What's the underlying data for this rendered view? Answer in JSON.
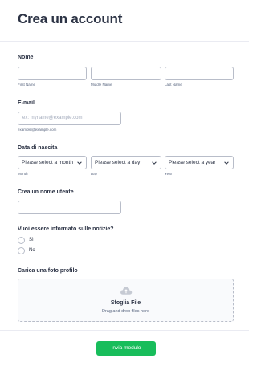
{
  "header": {
    "title": "Crea un account"
  },
  "name": {
    "label": "Nome",
    "fields": [
      {
        "sublabel": "First Name",
        "value": ""
      },
      {
        "sublabel": "Middle Name",
        "value": ""
      },
      {
        "sublabel": "Last Name",
        "value": ""
      }
    ]
  },
  "email": {
    "label": "E-mail",
    "placeholder": "ex: myname@example.com",
    "sublabel": "example@example.com"
  },
  "birthdate": {
    "label": "Data di nascita",
    "month": {
      "text": "Please select a month",
      "sublabel": "Month"
    },
    "day": {
      "text": "Please select a day",
      "sublabel": "Day"
    },
    "year": {
      "text": "Please select a year",
      "sublabel": "Year"
    }
  },
  "username": {
    "label": "Crea un nome utente",
    "value": ""
  },
  "newsletter": {
    "label": "Vuoi essere informato sulle notizie?",
    "options": [
      "Sì",
      "No"
    ]
  },
  "upload": {
    "label": "Carica una foto profilo",
    "title": "Sfoglia File",
    "subtitle": "Drag and drop files here",
    "icon": "cloud-upload-icon"
  },
  "submit": {
    "label": "Invia modulo"
  },
  "colors": {
    "accent": "#18bd5b",
    "text": "#2c3345",
    "border": "#b8bdc9"
  }
}
